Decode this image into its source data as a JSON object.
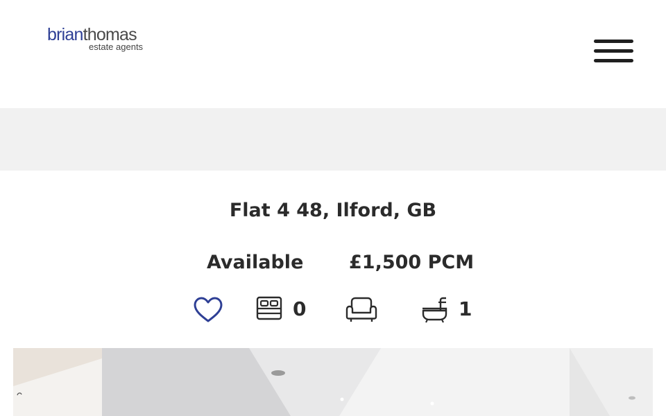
{
  "header": {
    "logo_part1": "brian",
    "logo_part2": "thomas",
    "logo_sub": "estate agents"
  },
  "property": {
    "title": "Flat 4 48, Ilford, GB",
    "status": "Available",
    "price": "£1,500 PCM",
    "bedrooms": "0",
    "bathrooms": "1"
  },
  "icons": {
    "favourite": "heart-icon",
    "bedrooms": "bed-icon",
    "reception": "armchair-icon",
    "bathrooms": "bathtub-icon",
    "menu": "hamburger-menu-icon"
  },
  "colors": {
    "brand_blue": "#2e3f95",
    "text": "#2b2b2b",
    "band": "#f1f1f1"
  }
}
